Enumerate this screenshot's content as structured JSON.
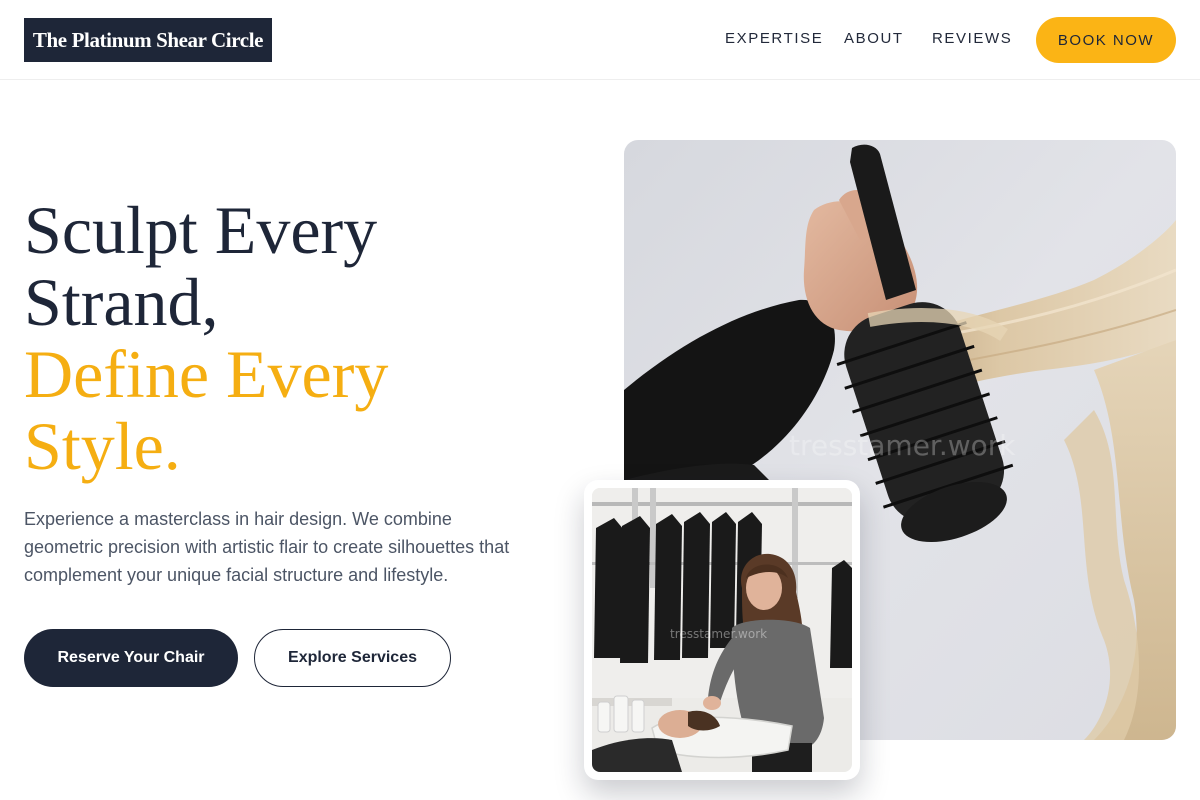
{
  "header": {
    "logo_text": "The Platinum Shear Circle",
    "nav": {
      "expertise": "EXPERTISE",
      "about": "ABOUT",
      "reviews": "REVIEWS"
    },
    "book_button": "BOOK NOW"
  },
  "hero": {
    "headline_line1": "Sculpt Every",
    "headline_line2": "Strand,",
    "headline_accent_line1": "Define Every",
    "headline_accent_line2": "Style.",
    "description": "Experience a masterclass in hair design. We combine geometric precision with artistic flair to create silhouettes that complement your unique facial structure and lifestyle.",
    "primary_button": "Reserve Your Chair",
    "secondary_button": "Explore Services"
  },
  "images": {
    "hero_watermark": "tresstamer.work",
    "secondary_watermark": "tresstamer.work"
  },
  "colors": {
    "navy": "#1e2638",
    "accent_gold": "#f5ae12",
    "button_gold": "#fbb415",
    "body_text": "#4c5565"
  }
}
